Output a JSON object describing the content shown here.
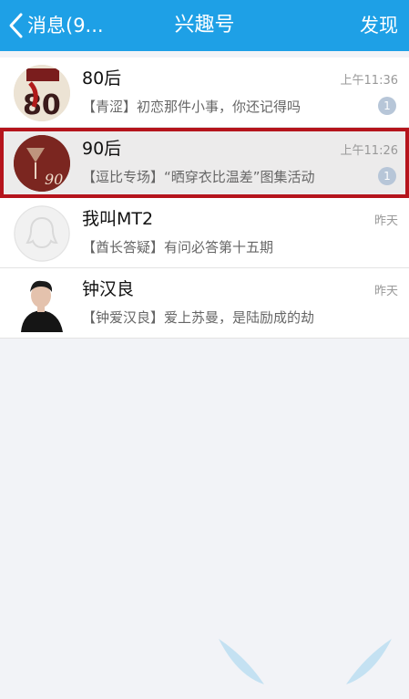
{
  "header": {
    "back_label": "消息(9...",
    "title": "兴趣号",
    "discover_label": "发现"
  },
  "items": [
    {
      "name": "80后",
      "time": "上午11:36",
      "preview": "【青涩】初恋那件小事，你还记得吗",
      "badge": "1",
      "avatar_text": "80"
    },
    {
      "name": "90后",
      "time": "上午11:26",
      "preview": "【逗比专场】“晒穿衣比温差”图集活动",
      "badge": "1",
      "avatar_text": "90"
    },
    {
      "name": "我叫MT2",
      "time": "昨天",
      "preview": "【酋长答疑】有问必答第十五期"
    },
    {
      "name": "钟汉良",
      "time": "昨天",
      "preview": "【钟爱汉良】爱上苏曼，是陆励成的劫"
    }
  ],
  "colors": {
    "header_bg": "#1ea0e6",
    "selected_outline": "#b5141c",
    "badge_bg": "#b7c6d8"
  }
}
